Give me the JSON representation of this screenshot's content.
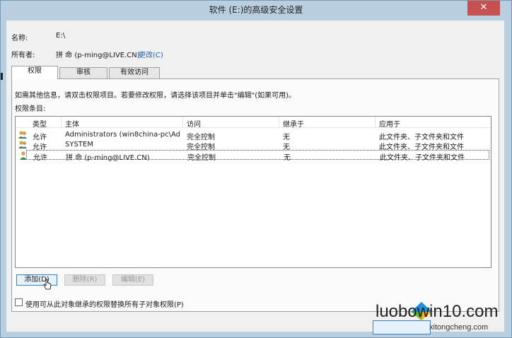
{
  "window": {
    "title": "软件 (E:)的高级安全设置",
    "close_glyph": "✕"
  },
  "info": {
    "name_label": "名称:",
    "name_value": "E:\\",
    "owner_label": "所有者:",
    "owner_value": "拼 命 (p-ming@LIVE.CN)",
    "change_link": "更改(C)"
  },
  "tabs": [
    {
      "label": "权限",
      "active": true
    },
    {
      "label": "审核",
      "active": false
    },
    {
      "label": "有效访问",
      "active": false
    }
  ],
  "panel": {
    "instructions": "如需其他信息，请双击权限项目。若要修改权限，请选择该项目并单击\"编辑\"(如果可用)。",
    "entries_label": "权限条目:"
  },
  "table": {
    "columns": [
      "类型",
      "主体",
      "访问",
      "继承于",
      "应用于"
    ],
    "rows": [
      {
        "type": "允许",
        "principal": "Administrators (win8china-pc\\Adm...",
        "access": "完全控制",
        "inherited": "无",
        "applies": "此文件夹、子文件夹和文件",
        "icon": "group-users-icon",
        "selected": false
      },
      {
        "type": "允许",
        "principal": "SYSTEM",
        "access": "完全控制",
        "inherited": "无",
        "applies": "此文件夹、子文件夹和文件",
        "icon": "group-users-icon",
        "selected": false
      },
      {
        "type": "允许",
        "principal": "拼 命 (p-ming@LIVE.CN)",
        "access": "完全控制",
        "inherited": "无",
        "applies": "此文件夹、子文件夹和文件",
        "icon": "single-user-icon",
        "selected": true
      }
    ]
  },
  "buttons": {
    "add": "添加(D)",
    "remove": "删除(R)",
    "edit": "编辑(E)"
  },
  "replace_checkbox": {
    "label": "使用可从此对象继承的权限替换所有子对象权限(P)",
    "checked": false
  },
  "watermark": {
    "main": "luobowin10.com",
    "sub": "xitongcheng.com"
  },
  "colors": {
    "frame": "#b9cfe0",
    "link": "#1a5fb4",
    "close": "#c75050",
    "focus": "#3c7fb1"
  }
}
